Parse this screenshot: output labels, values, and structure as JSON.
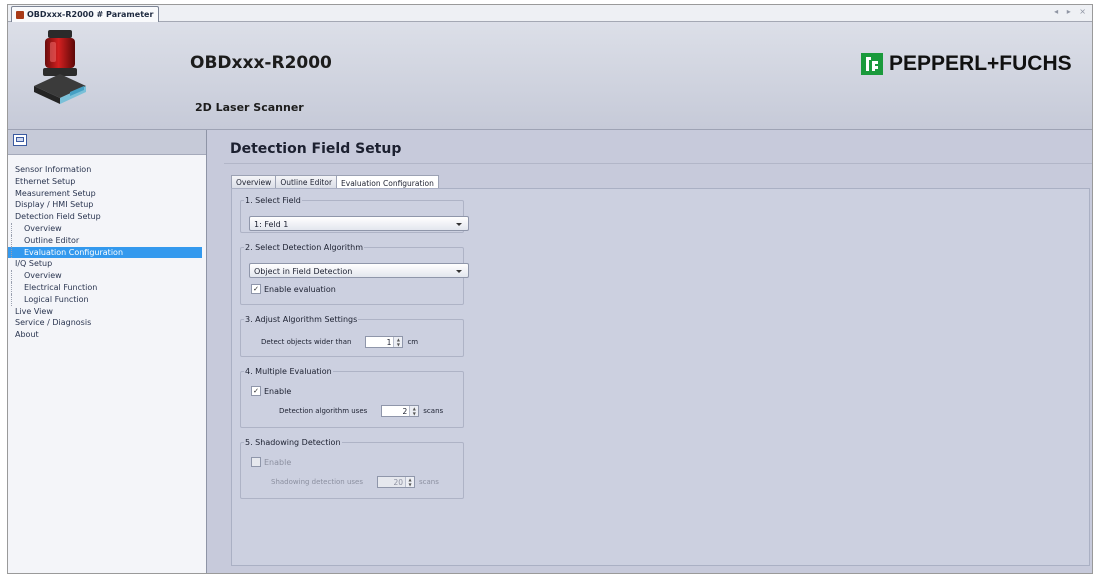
{
  "window": {
    "tab_title": "OBDxxx-R2000 # Parameter",
    "tab_controls": "◂ ▸ ×"
  },
  "header": {
    "title": "OBDxxx-R2000",
    "subtitle": "2D Laser Scanner",
    "brand": "PEPPERL+FUCHS",
    "brand_color": "#1a9a3c"
  },
  "sidebar": {
    "items": [
      {
        "label": "Sensor Information",
        "level": 0
      },
      {
        "label": "Ethernet Setup",
        "level": 0
      },
      {
        "label": "Measurement Setup",
        "level": 0
      },
      {
        "label": "Display / HMI Setup",
        "level": 0
      },
      {
        "label": "Detection Field Setup",
        "level": 0
      },
      {
        "label": "Overview",
        "level": 1
      },
      {
        "label": "Outline Editor",
        "level": 1
      },
      {
        "label": "Evaluation Configuration",
        "level": 1,
        "selected": true
      },
      {
        "label": "I/Q Setup",
        "level": 0
      },
      {
        "label": "Overview",
        "level": 1
      },
      {
        "label": "Electrical Function",
        "level": 1
      },
      {
        "label": "Logical Function",
        "level": 1
      },
      {
        "label": "Live View",
        "level": 0
      },
      {
        "label": "Service / Diagnosis",
        "level": 0
      },
      {
        "label": "About",
        "level": 0
      }
    ],
    "selected_color": "#3399ee"
  },
  "main": {
    "title": "Detection Field Setup",
    "tabs": [
      {
        "label": "Overview"
      },
      {
        "label": "Outline Editor"
      },
      {
        "label": "Evaluation Configuration",
        "active": true
      }
    ],
    "select_field": {
      "legend": "1. Select Field",
      "value": "1: Feld 1"
    },
    "algorithm": {
      "legend": "2. Select Detection Algorithm",
      "value": "Object in Field Detection",
      "enable_label": "Enable evaluation",
      "enable_checked": true
    },
    "adjust": {
      "legend": "3. Adjust Algorithm Settings",
      "label": "Detect objects wider than",
      "value": "1",
      "unit": "cm"
    },
    "multiple": {
      "legend": "4. Multiple Evaluation",
      "enable_label": "Enable",
      "enable_checked": true,
      "label": "Detection algorithm uses",
      "value": "2",
      "unit": "scans"
    },
    "shadowing": {
      "legend": "5. Shadowing Detection",
      "enable_label": "Enable",
      "enable_checked": false,
      "label": "Shadowing detection uses",
      "value": "20",
      "unit": "scans"
    }
  }
}
